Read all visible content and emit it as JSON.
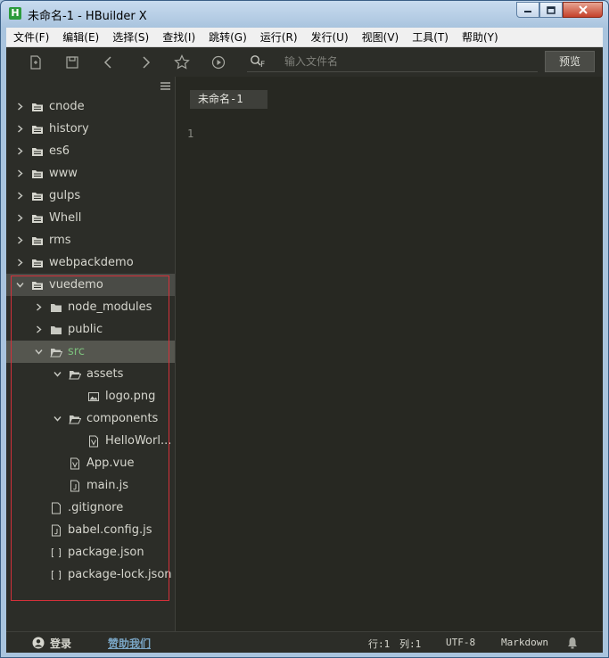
{
  "window": {
    "title": "未命名-1 - HBuilder X",
    "app_icon_letter": "H"
  },
  "menu": [
    "文件(F)",
    "编辑(E)",
    "选择(S)",
    "查找(I)",
    "跳转(G)",
    "运行(R)",
    "发行(U)",
    "视图(V)",
    "工具(T)",
    "帮助(Y)"
  ],
  "toolbar": {
    "search_icon_letter": "F",
    "search_placeholder": "输入文件名",
    "preview_label": "预览"
  },
  "tree": [
    {
      "label": "cnode",
      "depth": 0,
      "type": "folder",
      "expanded": false
    },
    {
      "label": "history",
      "depth": 0,
      "type": "folder",
      "expanded": false
    },
    {
      "label": "es6",
      "depth": 0,
      "type": "folder",
      "expanded": false
    },
    {
      "label": "www",
      "depth": 0,
      "type": "folder",
      "expanded": false
    },
    {
      "label": "gulps",
      "depth": 0,
      "type": "folder",
      "expanded": false
    },
    {
      "label": "Whell",
      "depth": 0,
      "type": "folder",
      "expanded": false
    },
    {
      "label": "rms",
      "depth": 0,
      "type": "folder",
      "expanded": false
    },
    {
      "label": "webpackdemo",
      "depth": 0,
      "type": "folder",
      "expanded": false
    },
    {
      "label": "vuedemo",
      "depth": 0,
      "type": "folder",
      "expanded": true,
      "selected": true
    },
    {
      "label": "node_modules",
      "depth": 1,
      "type": "folder-dark",
      "expanded": false
    },
    {
      "label": "public",
      "depth": 1,
      "type": "folder-dark",
      "expanded": false
    },
    {
      "label": "src",
      "depth": 1,
      "type": "folder-open",
      "expanded": true,
      "highlight": true
    },
    {
      "label": "assets",
      "depth": 2,
      "type": "folder-open",
      "expanded": true
    },
    {
      "label": "logo.png",
      "depth": 3,
      "type": "image"
    },
    {
      "label": "components",
      "depth": 2,
      "type": "folder-open",
      "expanded": true
    },
    {
      "label": "HelloWorl...",
      "depth": 3,
      "type": "vue"
    },
    {
      "label": "App.vue",
      "depth": 2,
      "type": "vue"
    },
    {
      "label": "main.js",
      "depth": 2,
      "type": "js"
    },
    {
      "label": ".gitignore",
      "depth": 1,
      "type": "file"
    },
    {
      "label": "babel.config.js",
      "depth": 1,
      "type": "js"
    },
    {
      "label": "package.json",
      "depth": 1,
      "type": "json"
    },
    {
      "label": "package-lock.json",
      "depth": 1,
      "type": "json"
    }
  ],
  "editor": {
    "tab_label": "未命名-1",
    "line_numbers": [
      "1"
    ]
  },
  "status": {
    "login": "登录",
    "help": "赞助我们",
    "row": "行:1",
    "col": "列:1",
    "encoding": "UTF-8",
    "language": "Markdown"
  },
  "colors": {
    "panel": "#2c2d28",
    "editor_bg": "#272822",
    "selection_border": "#d4303a",
    "src_text": "#7cc07c"
  }
}
